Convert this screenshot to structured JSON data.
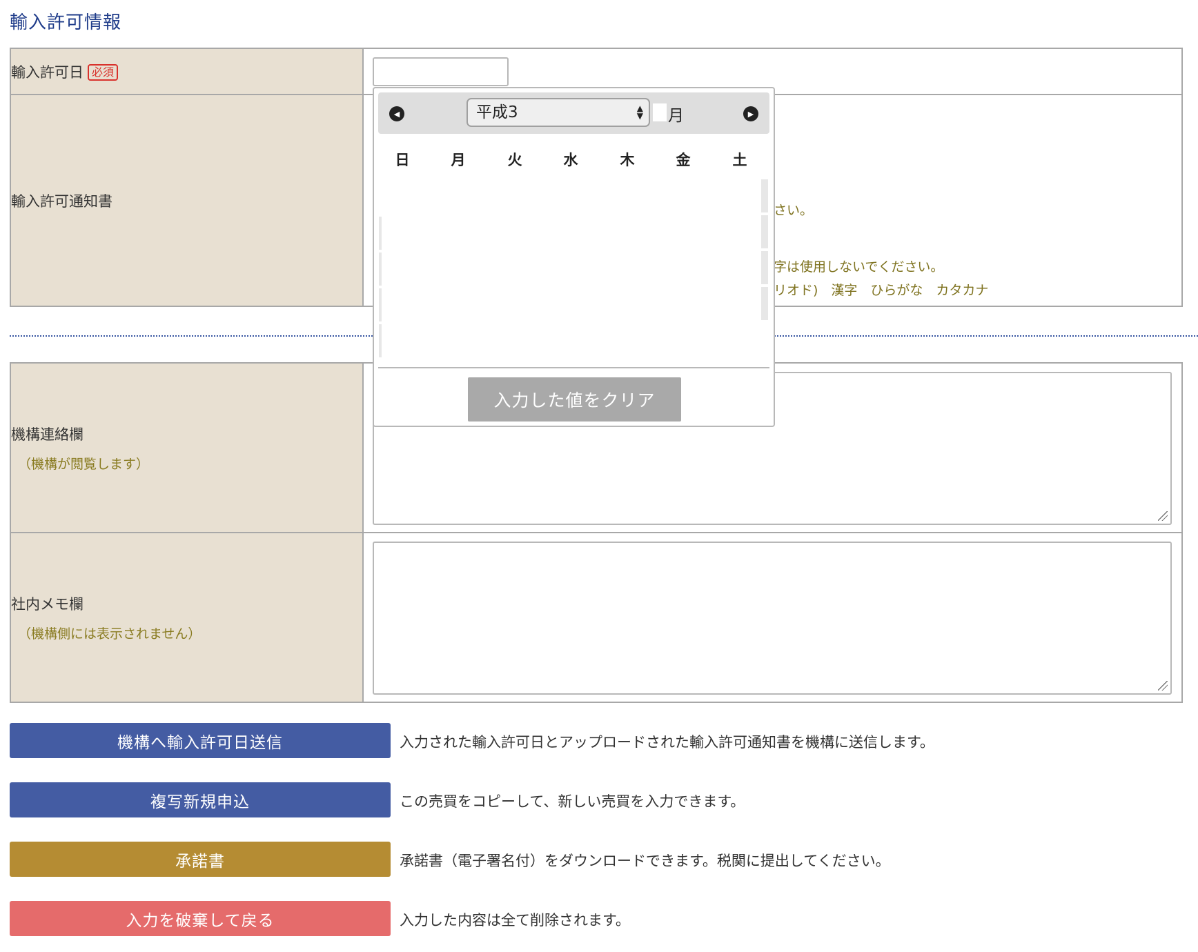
{
  "section": {
    "title": "輸入許可情報"
  },
  "rows": {
    "permit_date": {
      "label": "輸入許可日",
      "required": "必須"
    },
    "permit_notice": {
      "label": "輸入許可通知書",
      "hint1": "さい。",
      "hint2": "字は使用しないでください。",
      "hint3": "リオド)　漢字　ひらがな　カタカナ"
    },
    "agency_contact": {
      "label": "機構連絡欄",
      "sub": "（機構が閲覧します）"
    },
    "internal_memo": {
      "label": "社内メモ欄",
      "sub": "（機構側には表示されません）"
    }
  },
  "calendar": {
    "era_value": "平成3",
    "month_label": "月",
    "weekdays": [
      "日",
      "月",
      "火",
      "水",
      "木",
      "金",
      "土"
    ],
    "clear_label": "入力した値をクリア"
  },
  "actions": [
    {
      "label": "機構へ輸入許可日送信",
      "color": "#445ca3",
      "desc": "入力された輸入許可日とアップロードされた輸入許可通知書を機構に送信します。"
    },
    {
      "label": "複写新規申込",
      "color": "#445ca3",
      "desc": "この売買をコピーして、新しい売買を入力できます。"
    },
    {
      "label": "承諾書",
      "color": "#b58c33",
      "desc": "承諾書（電子署名付）をダウンロードできます。税関に提出してください。"
    },
    {
      "label": "入力を破棄して戻る",
      "color": "#e56b6b",
      "desc": "入力した内容は全て削除されます。"
    }
  ]
}
